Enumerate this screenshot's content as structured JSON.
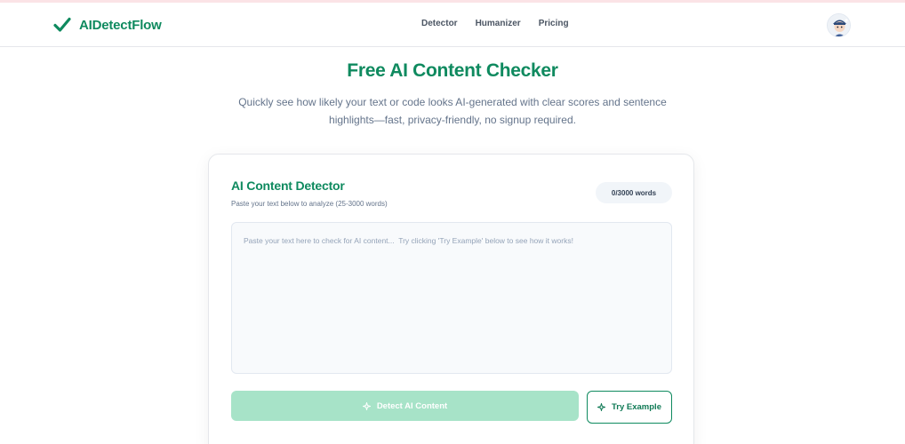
{
  "brand": {
    "name": "AIDetectFlow",
    "logo_icon": "checkmark-icon",
    "color": "#0f8a5f"
  },
  "nav": {
    "links": [
      "Detector",
      "Humanizer",
      "Pricing"
    ]
  },
  "hero": {
    "title": "Free AI Content Checker",
    "subtitle": "Quickly see how likely your text or code looks AI-generated with clear scores and sentence highlights—fast, privacy-friendly, no signup required."
  },
  "detector": {
    "title": "AI Content Detector",
    "subtitle": "Paste your text below to analyze (25-3000 words)",
    "word_count": "0/3000 words",
    "input_value": "",
    "placeholder": "Paste your text here to check for AI content...  Try clicking 'Try Example' below to see how it works!",
    "detect_label": "Detect AI Content",
    "detect_icon": "sparkle-icon",
    "try_label": "Try Example",
    "try_icon": "sparkle-icon"
  },
  "colors": {
    "accent": "#0f8a5f",
    "detect_disabled": "#a7e3c8"
  }
}
